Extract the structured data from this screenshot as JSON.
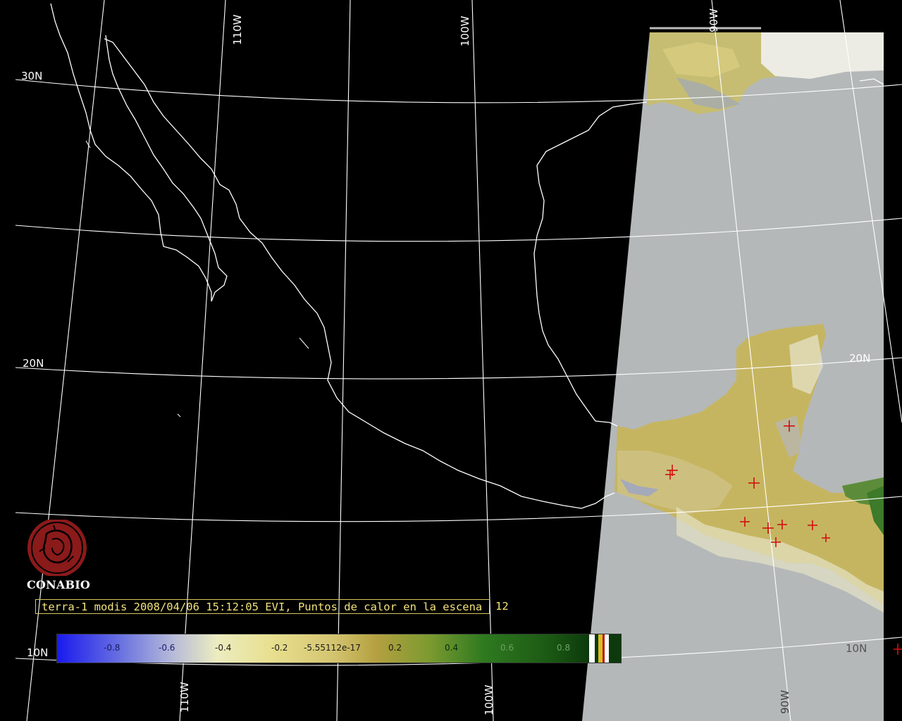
{
  "map": {
    "graticule_labels": {
      "lon_110w_top": "110W",
      "lon_100w_top": "100W",
      "lon_90w_top": "90W",
      "lat_30n": "30N",
      "lat_20n_left": "20N",
      "lat_20n_right": "20N",
      "lat_10n_left": "10N",
      "lat_10n_right": "10N",
      "lon_110w_bottom": "110W",
      "lon_100w_bottom": "100W",
      "lon_90w_bottom": "90W"
    },
    "colors": {
      "background": "#000000",
      "coastline": "#ffffff",
      "graticule": "#ffffff",
      "scene_gray": "#b4b8b8",
      "vegetation_tan": "#c8b860",
      "hotspot": "#cc1010"
    }
  },
  "logo": {
    "name": "CONABIO",
    "icon": "conabio-seal-icon",
    "color": "#8b1a1a"
  },
  "caption": {
    "text": "terra-1 modis 2008/04/06 15:12:05 EVI, Puntos de calor en la escena",
    "count": "12"
  },
  "colorbar": {
    "ticks": [
      "-0.8",
      "-0.6",
      "-0.4",
      "-0.2",
      "-5.55112e-17",
      "0.2",
      "0.4",
      "0.6",
      "0.8"
    ]
  }
}
